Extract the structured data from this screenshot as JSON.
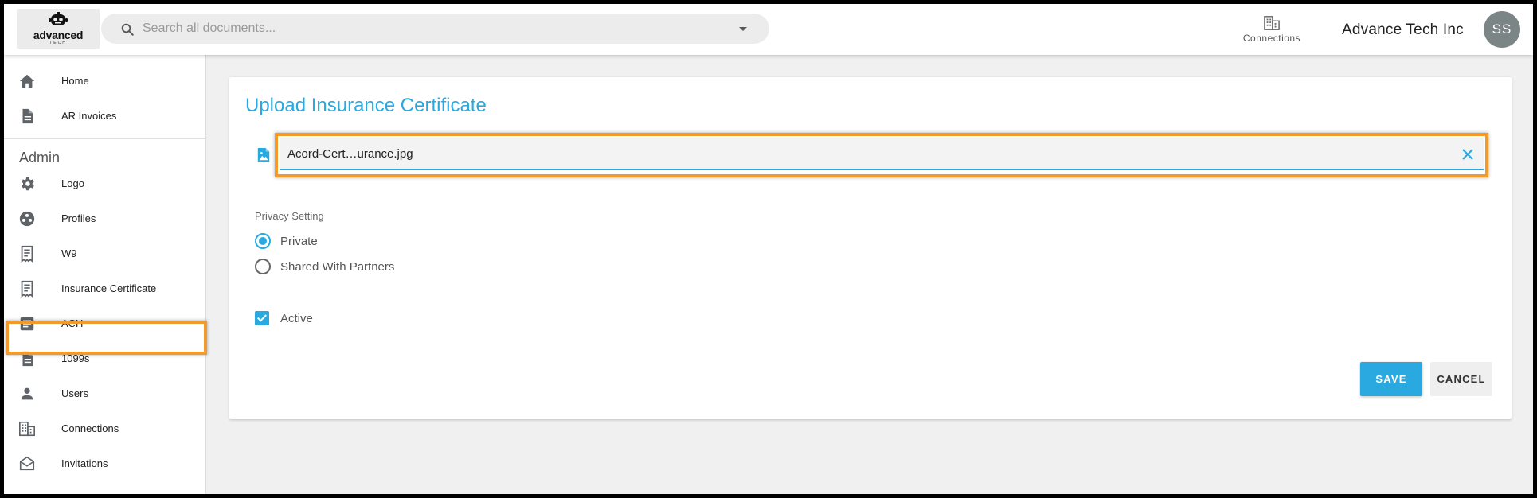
{
  "header": {
    "logo_text": "advanced",
    "logo_subtext": "TECH",
    "search_placeholder": "Search all documents...",
    "connections_label": "Connections",
    "company_name": "Advance Tech Inc",
    "avatar_initials": "SS"
  },
  "sidebar": {
    "top_items": [
      {
        "label": "Home",
        "icon": "home-icon"
      },
      {
        "label": "AR Invoices",
        "icon": "document-icon"
      }
    ],
    "admin_heading": "Admin",
    "admin_items": [
      {
        "label": "Logo",
        "icon": "gear-icon"
      },
      {
        "label": "Profiles",
        "icon": "profiles-icon"
      },
      {
        "label": "W9",
        "icon": "receipt-icon"
      },
      {
        "label": "Insurance Certificate",
        "icon": "receipt-icon",
        "highlighted": true
      },
      {
        "label": "ACH",
        "icon": "article-icon"
      },
      {
        "label": "1099s",
        "icon": "document-icon"
      },
      {
        "label": "Users",
        "icon": "person-icon"
      },
      {
        "label": "Connections",
        "icon": "building-icon"
      },
      {
        "label": "Invitations",
        "icon": "envelope-icon"
      }
    ]
  },
  "main": {
    "title": "Upload Insurance Certificate",
    "file_name": "Acord-Cert…urance.jpg",
    "privacy_label": "Privacy Setting",
    "privacy_options": [
      {
        "label": "Private",
        "selected": true
      },
      {
        "label": "Shared With Partners",
        "selected": false
      }
    ],
    "active_label": "Active",
    "active_checked": true,
    "save_label": "SAVE",
    "cancel_label": "CANCEL"
  },
  "colors": {
    "accent": "#29a9e0",
    "highlight": "#f29b2c",
    "icon_gray": "#5f6368"
  }
}
